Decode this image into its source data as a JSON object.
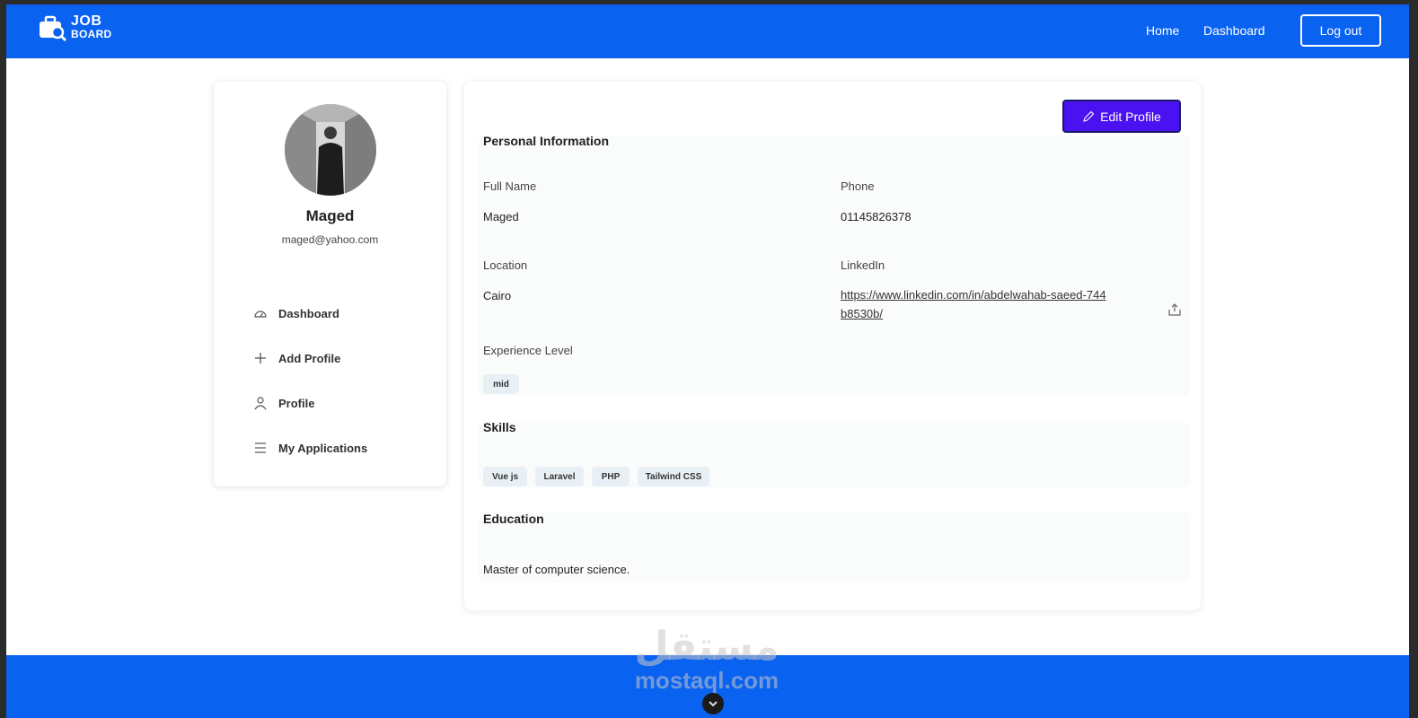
{
  "navbar": {
    "logo_line1": "JOB",
    "logo_line2": "BOARD",
    "home": "Home",
    "dashboard": "Dashboard",
    "logout": "Log out"
  },
  "user": {
    "name": "Maged",
    "email": "maged@yahoo.com"
  },
  "sidebar": {
    "items": [
      {
        "label": "Dashboard",
        "icon": "dashboard-icon"
      },
      {
        "label": "Add Profile",
        "icon": "plus-icon"
      },
      {
        "label": "Profile",
        "icon": "user-icon"
      },
      {
        "label": "My Applications",
        "icon": "list-icon"
      }
    ]
  },
  "profile": {
    "edit_label": "Edit Profile",
    "personal_title": "Personal Information",
    "full_name_label": "Full Name",
    "full_name": "Maged",
    "phone_label": "Phone",
    "phone": "01145826378",
    "location_label": "Location",
    "location": "Cairo",
    "linkedin_label": "LinkedIn",
    "linkedin": "https://www.linkedin.com/in/abdelwahab-saeed-744b8530b/",
    "experience_label": "Experience Level",
    "experience": "mid",
    "skills_title": "Skills",
    "skills": [
      "Vue js",
      "Laravel",
      "PHP",
      "Tailwind CSS"
    ],
    "education_title": "Education",
    "education": "Master of computer science."
  },
  "watermark": {
    "arabic": "مستقل",
    "latin": "mostaql.com"
  },
  "colors": {
    "primary": "#0a62f0",
    "edit_button": "#4a12f0"
  }
}
